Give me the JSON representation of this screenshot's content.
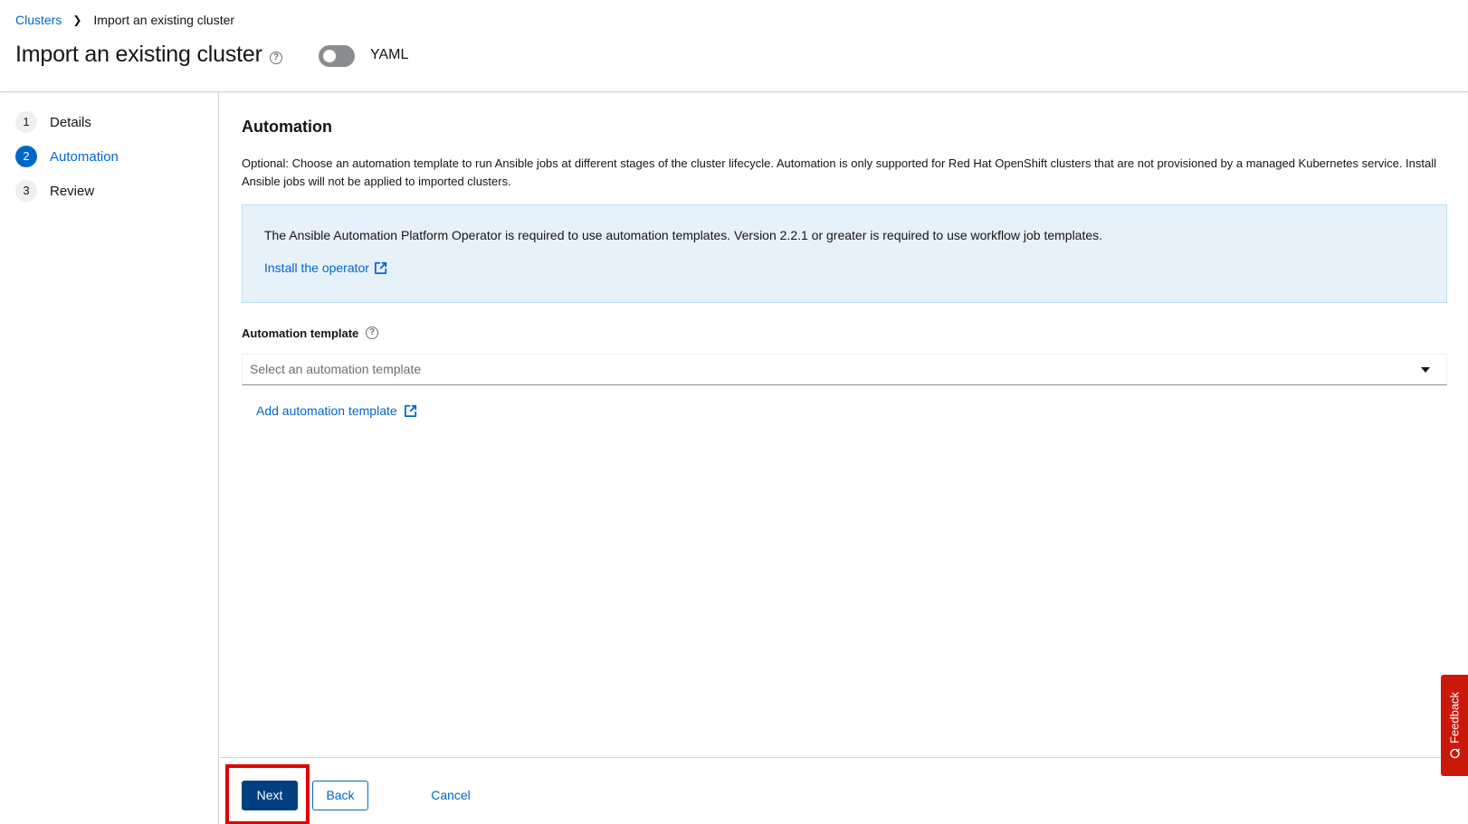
{
  "breadcrumb": {
    "parent": "Clusters",
    "current": "Import an existing cluster"
  },
  "header": {
    "title": "Import an existing cluster",
    "toggle_label": "YAML",
    "toggle_on": false
  },
  "steps": [
    {
      "number": "1",
      "label": "Details",
      "active": false
    },
    {
      "number": "2",
      "label": "Automation",
      "active": true
    },
    {
      "number": "3",
      "label": "Review",
      "active": false
    }
  ],
  "main": {
    "title": "Automation",
    "description": "Optional: Choose an automation template to run Ansible jobs at different stages of the cluster lifecycle. Automation is only supported for Red Hat OpenShift clusters that are not provisioned by a managed Kubernetes service. Install Ansible jobs will not be applied to imported clusters.",
    "info": {
      "text": "The Ansible Automation Platform Operator is required to use automation templates. Version 2.2.1 or greater is required to use workflow job templates.",
      "link": "Install the operator"
    },
    "field_label": "Automation template",
    "select_placeholder": "Select an automation template",
    "add_link": "Add automation template"
  },
  "footer": {
    "next": "Next",
    "back": "Back",
    "cancel": "Cancel"
  },
  "feedback": "Feedback",
  "colors": {
    "link": "#0066cc",
    "primary": "#004080",
    "highlight": "#e00000",
    "feedback": "#c9190b"
  }
}
